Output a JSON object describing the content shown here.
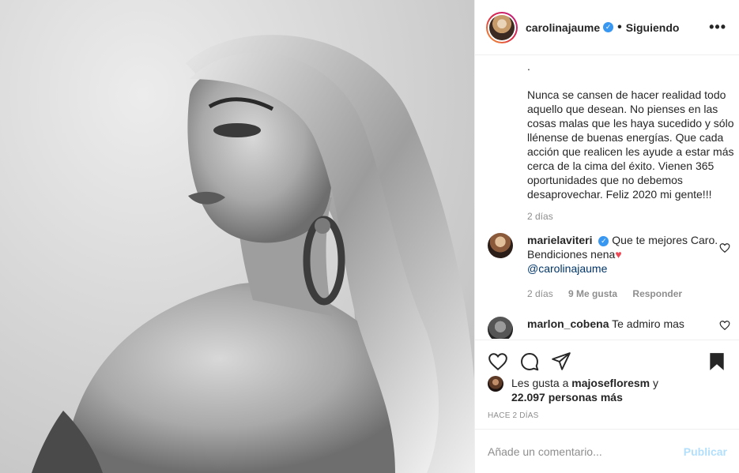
{
  "post": {
    "username": "carolinajaume",
    "follow_dot": "•",
    "follow_status": "Siguiendo",
    "more_label": "•••",
    "caption": ".\n\nNunca se cansen de hacer realidad todo aquello que desean. No pienses en las cosas malas que les haya sucedido y sólo llénense de buenas energías. Que cada acción que realicen les ayude a estar más cerca de la cima del éxito. Vienen 365 oportunidades que no debemos desaprovechar. Feliz 2020 mi gente!!!",
    "caption_time": "2 días",
    "comments": [
      {
        "user": "marielaviteri",
        "text": "Que te mejores Caro. Bendiciones nena",
        "mention": "@carolinajaume",
        "time": "2 días",
        "likes": "9 Me gusta",
        "reply": "Responder"
      },
      {
        "user": "marlon_cobena",
        "text": "Te admiro mas"
      }
    ],
    "likes_prefix": "Les gusta a",
    "likes_user": "majosefloresm",
    "likes_and": "y",
    "likes_count": "22.097 personas más",
    "posted_time": "Hace 2 días",
    "comment_placeholder": "Añade un comentario...",
    "publish_label": "Publicar",
    "verified_mark": "✓"
  },
  "colors": {
    "accent": "#3897f0",
    "publish_disabled": "#b2dffc",
    "heart": "#ed4956"
  }
}
